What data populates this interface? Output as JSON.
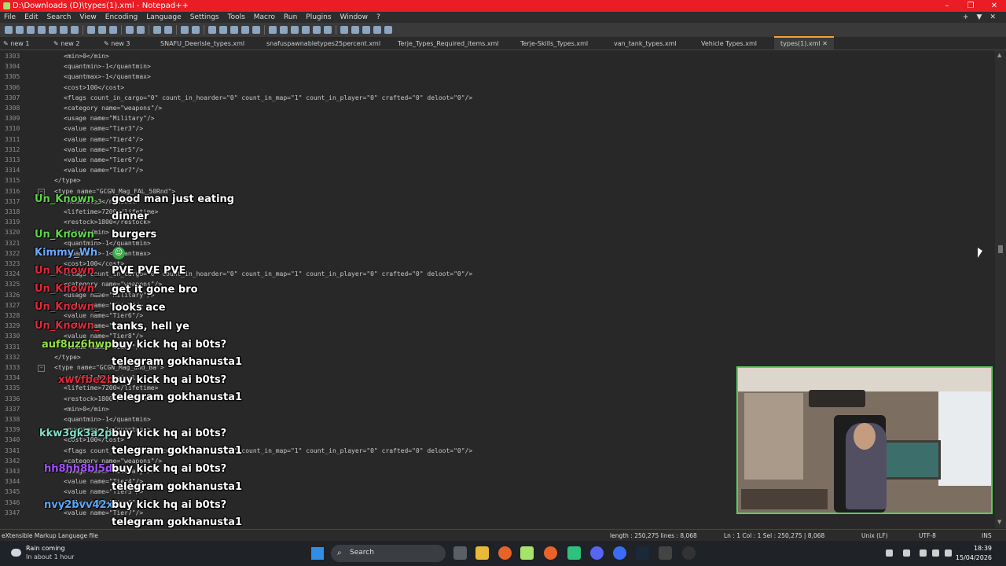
{
  "window": {
    "title": "D:\\Downloads (D)\\types(1).xml - Notepad++",
    "controls": [
      "–",
      "❐",
      "✕"
    ]
  },
  "menu": {
    "items": [
      "File",
      "Edit",
      "Search",
      "View",
      "Encoding",
      "Language",
      "Settings",
      "Tools",
      "Macro",
      "Run",
      "Plugins",
      "Window",
      "?"
    ],
    "right": [
      "+",
      "▼",
      "✕"
    ]
  },
  "tabs": [
    {
      "label": "new 1"
    },
    {
      "label": "new 2"
    },
    {
      "label": "new 3"
    },
    {
      "label": "SNAFU_Deerisle_types.xml"
    },
    {
      "label": "snafuspawnabletypes25percent.xml"
    },
    {
      "label": "Terje_Types_Required_items.xml"
    },
    {
      "label": "Terje-Skills_Types.xml"
    },
    {
      "label": "van_tank_types.xml"
    },
    {
      "label": "Vehicle Types.xml"
    },
    {
      "label": "types(1).xml"
    }
  ],
  "code_lines": [
    {
      "n": "3303",
      "t": "<min>0</min>"
    },
    {
      "n": "3304",
      "t": "<quantmin>-1</quantmin>"
    },
    {
      "n": "3305",
      "t": "<quantmax>-1</quantmax>"
    },
    {
      "n": "3306",
      "t": "<cost>100</cost>"
    },
    {
      "n": "3307",
      "t": "<flags count_in_cargo=\"0\" count_in_hoarder=\"0\" count_in_map=\"1\" count_in_player=\"0\" crafted=\"0\" deloot=\"0\"/>"
    },
    {
      "n": "3308",
      "t": "<category name=\"weapons\"/>"
    },
    {
      "n": "3309",
      "t": "<usage name=\"Military\"/>"
    },
    {
      "n": "3310",
      "t": "<value name=\"Tier3\"/>"
    },
    {
      "n": "3311",
      "t": "<value name=\"Tier4\"/>"
    },
    {
      "n": "3312",
      "t": "<value name=\"Tier5\"/>"
    },
    {
      "n": "3313",
      "t": "<value name=\"Tier6\"/>"
    },
    {
      "n": "3314",
      "t": "<value name=\"Tier7\"/>"
    },
    {
      "n": "3315",
      "t": "</type>"
    },
    {
      "n": "3316",
      "t": "<type name=\"GCGN_Mag_FAL_50Rnd\">"
    },
    {
      "n": "3317",
      "t": "<nominal>3</nominal>"
    },
    {
      "n": "3318",
      "t": "<lifetime>7200</lifetime>"
    },
    {
      "n": "3319",
      "t": "<restock>1800</restock>"
    },
    {
      "n": "3320",
      "t": "<min>1</min>"
    },
    {
      "n": "3321",
      "t": "<quantmin>-1</quantmin>"
    },
    {
      "n": "3322",
      "t": "<quantmax>-1</quantmax>"
    },
    {
      "n": "3323",
      "t": "<cost>100</cost>"
    },
    {
      "n": "3324",
      "t": "<flags count_in_cargo=\"0\" count_in_hoarder=\"0\" count_in_map=\"1\" count_in_player=\"0\" crafted=\"0\" deloot=\"0\"/>"
    },
    {
      "n": "3325",
      "t": "<category name=\"weapons\"/>"
    },
    {
      "n": "3326",
      "t": "<usage name=\"Military\"/>"
    },
    {
      "n": "3327",
      "t": "<value name=\"Tier5\"/>"
    },
    {
      "n": "3328",
      "t": "<value name=\"Tier6\"/>"
    },
    {
      "n": "3329",
      "t": "<value name=\"Tier7\"/>"
    },
    {
      "n": "3330",
      "t": "<value name=\"Tier8\"/>"
    },
    {
      "n": "3331",
      "t": "<value name=\"Tier9\"/>"
    },
    {
      "n": "3332",
      "t": "</type>"
    },
    {
      "n": "3333",
      "t": "<type name=\"GCGN_Mag_and_Ba\">"
    },
    {
      "n": "3334",
      "t": "<nominal>5</nominal>"
    },
    {
      "n": "3335",
      "t": "<lifetime>7200</lifetime>"
    },
    {
      "n": "3336",
      "t": "<restock>1800</restock>"
    },
    {
      "n": "3337",
      "t": "<min>0</min>"
    },
    {
      "n": "3338",
      "t": "<quantmin>-1</quantmin>"
    },
    {
      "n": "3339",
      "t": "<quantmax>-1</quantmax>"
    },
    {
      "n": "3340",
      "t": "<cost>100</cost>"
    },
    {
      "n": "3341",
      "t": "<flags count_in_cargo=\"0\" count_in_hoarder=\"0\" count_in_map=\"1\" count_in_player=\"0\" crafted=\"0\" deloot=\"0\"/>"
    },
    {
      "n": "3342",
      "t": "<category name=\"weapons\"/>"
    },
    {
      "n": "3343",
      "t": "<usage name=\"Military\"/>"
    },
    {
      "n": "3344",
      "t": "<value name=\"Tier4\"/>"
    },
    {
      "n": "3345",
      "t": "<value name=\"Tier5\"/>"
    },
    {
      "n": "3346",
      "t": "<value name=\"Tier6\"/>"
    },
    {
      "n": "3347",
      "t": "<value name=\"Tier7\"/>"
    }
  ],
  "chat": {
    "names": [
      {
        "text": "Un_Known_",
        "color": "#5ed64a"
      },
      {
        "text": "Un_Known_",
        "color": "#5ed64a"
      },
      {
        "text": "Kimmy_Wh",
        "color": "#6aa9ff"
      },
      {
        "text": "Un_Known_",
        "color": "#e0283c"
      },
      {
        "text": "Un_Known_",
        "color": "#e0283c"
      },
      {
        "text": "Un_Known_",
        "color": "#e0283c"
      },
      {
        "text": "Un_Known_",
        "color": "#e0283c"
      },
      {
        "text": "auf8uz6hwp",
        "color": "#93e046"
      },
      {
        "text": "xwvfbe2b",
        "color": "#e0283c"
      },
      {
        "text": "kkw3gk3a2p",
        "color": "#7fe0c8"
      },
      {
        "text": "hh8hh8bl5d",
        "color": "#a451ff"
      },
      {
        "text": "nvy2bvv42x",
        "color": "#5aa9ff"
      }
    ],
    "messages": [
      "good man just eating",
      "dinner",
      "burgers",
      "PVE PVE PVE",
      "get it gone bro",
      "looks ace",
      "tanks, hell ye",
      "buy kick hq ai b0ts?",
      "telegram gokhanusta1",
      "buy kick hq ai b0ts?",
      "telegram gokhanusta1",
      "buy kick hq ai b0ts?",
      "telegram gokhanusta1",
      "buy kick hq ai b0ts?",
      "telegram gokhanusta1",
      "buy kick hq ai b0ts?",
      "telegram gokhanusta1"
    ]
  },
  "status": {
    "file_type": "eXtensible Markup Language file",
    "length": "length : 250,275    lines : 8,068",
    "position": "Ln : 1    Col : 1    Sel : 250,275 | 8,068",
    "eol": "Unix (LF)",
    "encoding": "UTF-8",
    "mode": "INS"
  },
  "taskbar": {
    "weather_title": "Rain coming",
    "weather_sub": "In about 1 hour",
    "search_label": "Search",
    "time": "18:39",
    "date": "15/04/2026"
  },
  "colors": {
    "titlebar": "#ea1c24",
    "active_tab_accent": "#f2a133",
    "webcam_border": "#5ad05a"
  }
}
